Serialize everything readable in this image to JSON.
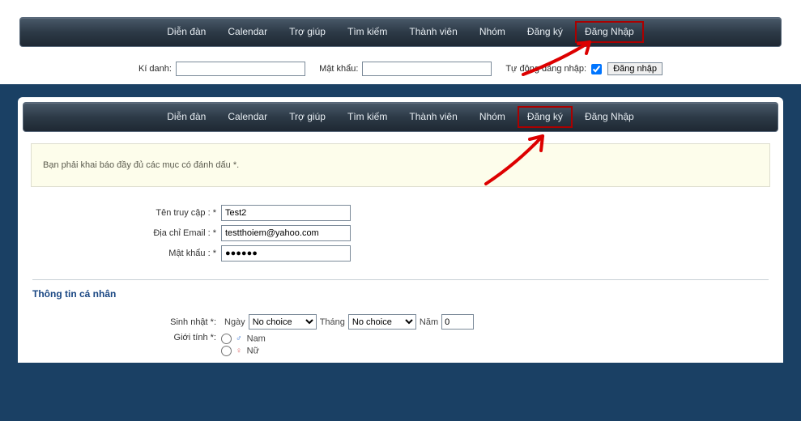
{
  "top_nav": {
    "items": [
      "Diễn đàn",
      "Calendar",
      "Trợ giúp",
      "Tìm kiếm",
      "Thành viên",
      "Nhóm",
      "Đăng ký",
      "Đăng Nhập"
    ],
    "highlight_index": 7
  },
  "login_bar": {
    "user_label": "Kí danh:",
    "pass_label": "Mật khẩu:",
    "auto_label": "Tự động đăng nhập:",
    "auto_checked": true,
    "submit": "Đăng nhập"
  },
  "inner_nav": {
    "items": [
      "Diễn đàn",
      "Calendar",
      "Trợ giúp",
      "Tìm kiếm",
      "Thành viên",
      "Nhóm",
      "Đăng ký",
      "Đăng Nhập"
    ],
    "highlight_index": 6
  },
  "notice": "Bạn phải khai báo đầy đủ các mục có đánh dấu *.",
  "reg_form": {
    "username_label": "Tên truy cập : *",
    "username_value": "Test2",
    "email_label": "Địa chỉ Email : *",
    "email_value": "testthoiem@yahoo.com",
    "password_label": "Mật khẩu : *",
    "password_value": "●●●●●●"
  },
  "section_title": "Thông tin cá nhân",
  "birthday": {
    "label": "Sinh nhật *:",
    "day_lbl": "Ngày",
    "day_val": "No choice",
    "month_lbl": "Tháng",
    "month_val": "No choice",
    "year_lbl": "Năm",
    "year_val": "0"
  },
  "gender": {
    "label": "Giới tính *:",
    "male": "Nam",
    "female": "Nữ"
  }
}
